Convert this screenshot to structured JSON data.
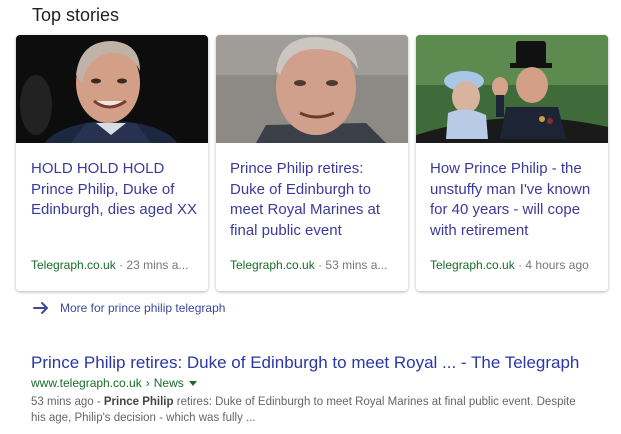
{
  "section": {
    "title": "Top stories"
  },
  "cards": [
    {
      "headline": "HOLD HOLD HOLD Prince Philip, Duke of Edinburgh, dies aged XX",
      "site": "Telegraph.co.uk",
      "separator": " · ",
      "age": "23 mins a..."
    },
    {
      "headline": "Prince Philip retires: Duke of Edinburgh to meet Royal Marines at final public event",
      "site": "Telegraph.co.uk",
      "separator": " · ",
      "age": "53 mins a..."
    },
    {
      "headline": "How Prince Philip - the unstuffy man I've known for 40 years - will cope with retirement",
      "site": "Telegraph.co.uk",
      "separator": " · ",
      "age": "4 hours ago"
    }
  ],
  "more": {
    "label": "More for prince philip telegraph",
    "icon": "arrow-right-icon"
  },
  "result": {
    "title": "Prince Philip retires: Duke of Edinburgh to meet Royal ... - The Telegraph",
    "url": "www.telegraph.co.uk",
    "breadcrumb_sep": "›",
    "section": "News",
    "snippet_age": "53 mins ago - ",
    "snippet_bold": "Prince Philip",
    "snippet_rest": " retires: Duke of Edinburgh to meet Royal Marines at final public event. Despite his age, Philip's decision - which was fully ..."
  },
  "colors": {
    "headline": "#3c3a9c",
    "result_title": "#2a37a5",
    "source_site": "#1a6b2a"
  }
}
